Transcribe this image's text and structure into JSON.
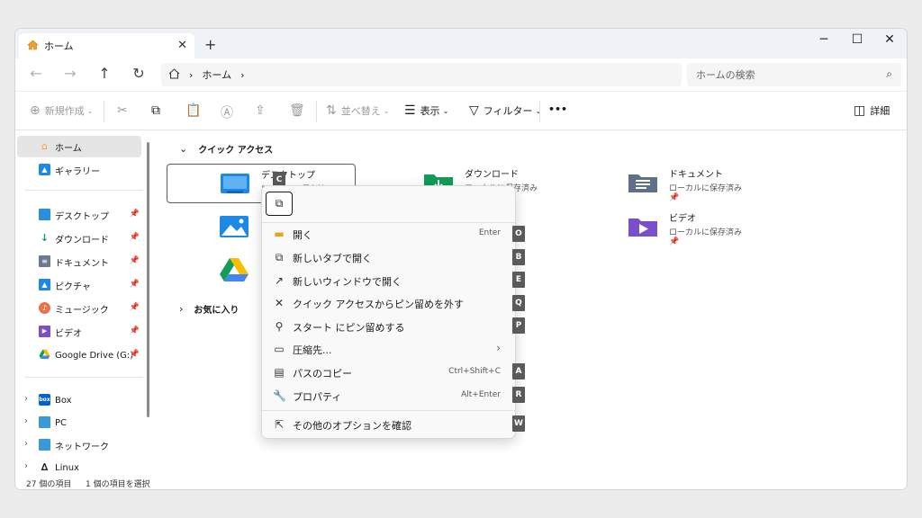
{
  "window": {
    "tab_title": "ホーム",
    "tab_close": "✕",
    "new_tab": "+",
    "minimize": "─",
    "maximize": "☐",
    "close": "✕"
  },
  "nav": {
    "back": "←",
    "forward": "→",
    "up": "↑",
    "refresh": "↻",
    "breadcrumb_home_icon": "home-icon",
    "breadcrumb_sep": "›",
    "breadcrumb_location": "ホーム",
    "breadcrumb_trailing": "›",
    "search_placeholder": "ホームの検索"
  },
  "toolbar": {
    "new_label": "新規作成",
    "sort_label": "並べ替え",
    "view_label": "表示",
    "filter_label": "フィルター",
    "more_label": "•••",
    "details_label": "詳細"
  },
  "sidebar": {
    "home": "ホーム",
    "gallery": "ギャラリー",
    "pinned": [
      {
        "label": "デスクトップ",
        "icon": "desktop-icon"
      },
      {
        "label": "ダウンロード",
        "icon": "download-icon"
      },
      {
        "label": "ドキュメント",
        "icon": "documents-icon"
      },
      {
        "label": "ピクチャ",
        "icon": "pictures-icon"
      },
      {
        "label": "ミュージック",
        "icon": "music-icon"
      },
      {
        "label": "ビデオ",
        "icon": "videos-icon"
      },
      {
        "label": "Google Drive (G:)",
        "icon": "google-drive-icon"
      }
    ],
    "roots": [
      {
        "label": "Box",
        "icon": "box-icon"
      },
      {
        "label": "PC",
        "icon": "pc-icon"
      },
      {
        "label": "ネットワーク",
        "icon": "network-icon"
      },
      {
        "label": "Linux",
        "icon": "linux-icon"
      }
    ]
  },
  "main": {
    "quick_access_title": "クイック アクセス",
    "favorites_title": "お気に入り",
    "items": [
      {
        "name": "デスクトップ",
        "sub": "ローカルに保存済み"
      },
      {
        "name": "ダウンロード",
        "sub": "ローカルに保存済み"
      },
      {
        "name": "ドキュメント",
        "sub": "ローカルに保存済み"
      },
      {
        "name": "ビデオ",
        "sub": "ローカルに保存済み"
      }
    ],
    "partial_sub": "み"
  },
  "status": {
    "count": "27 個の項目",
    "selected": "1 個の項目を選択"
  },
  "context_menu": {
    "copy_keytip": "C",
    "items": [
      {
        "label": "開く",
        "key": "Enter",
        "keytip": "O",
        "icon": "folder-open-icon"
      },
      {
        "label": "新しいタブで開く",
        "key": "",
        "keytip": "B",
        "icon": "new-tab-icon"
      },
      {
        "label": "新しいウィンドウで開く",
        "key": "",
        "keytip": "E",
        "icon": "new-window-icon"
      },
      {
        "label": "クイック アクセスからピン留めを外す",
        "key": "",
        "keytip": "Q",
        "icon": "unpin-icon"
      },
      {
        "label": "スタート にピン留めする",
        "key": "",
        "keytip": "P",
        "icon": "pin-icon"
      },
      {
        "label": "圧縮先...",
        "key": "",
        "keytip": "",
        "icon": "compress-icon"
      },
      {
        "label": "パスのコピー",
        "key": "Ctrl+Shift+C",
        "keytip": "A",
        "icon": "copy-path-icon"
      },
      {
        "label": "プロパティ",
        "key": "Alt+Enter",
        "keytip": "R",
        "icon": "properties-icon"
      }
    ],
    "more_options": {
      "label": "その他のオプションを確認",
      "keytip": "W",
      "icon": "more-options-icon"
    }
  },
  "colors": {
    "accent": "#0067c0",
    "folder_blue": "#1e88e5",
    "folder_green": "#0f9d58",
    "folder_purple": "#7b4fc9",
    "folder_gray": "#5f7089",
    "keytip_bg": "#5a5a5a"
  }
}
